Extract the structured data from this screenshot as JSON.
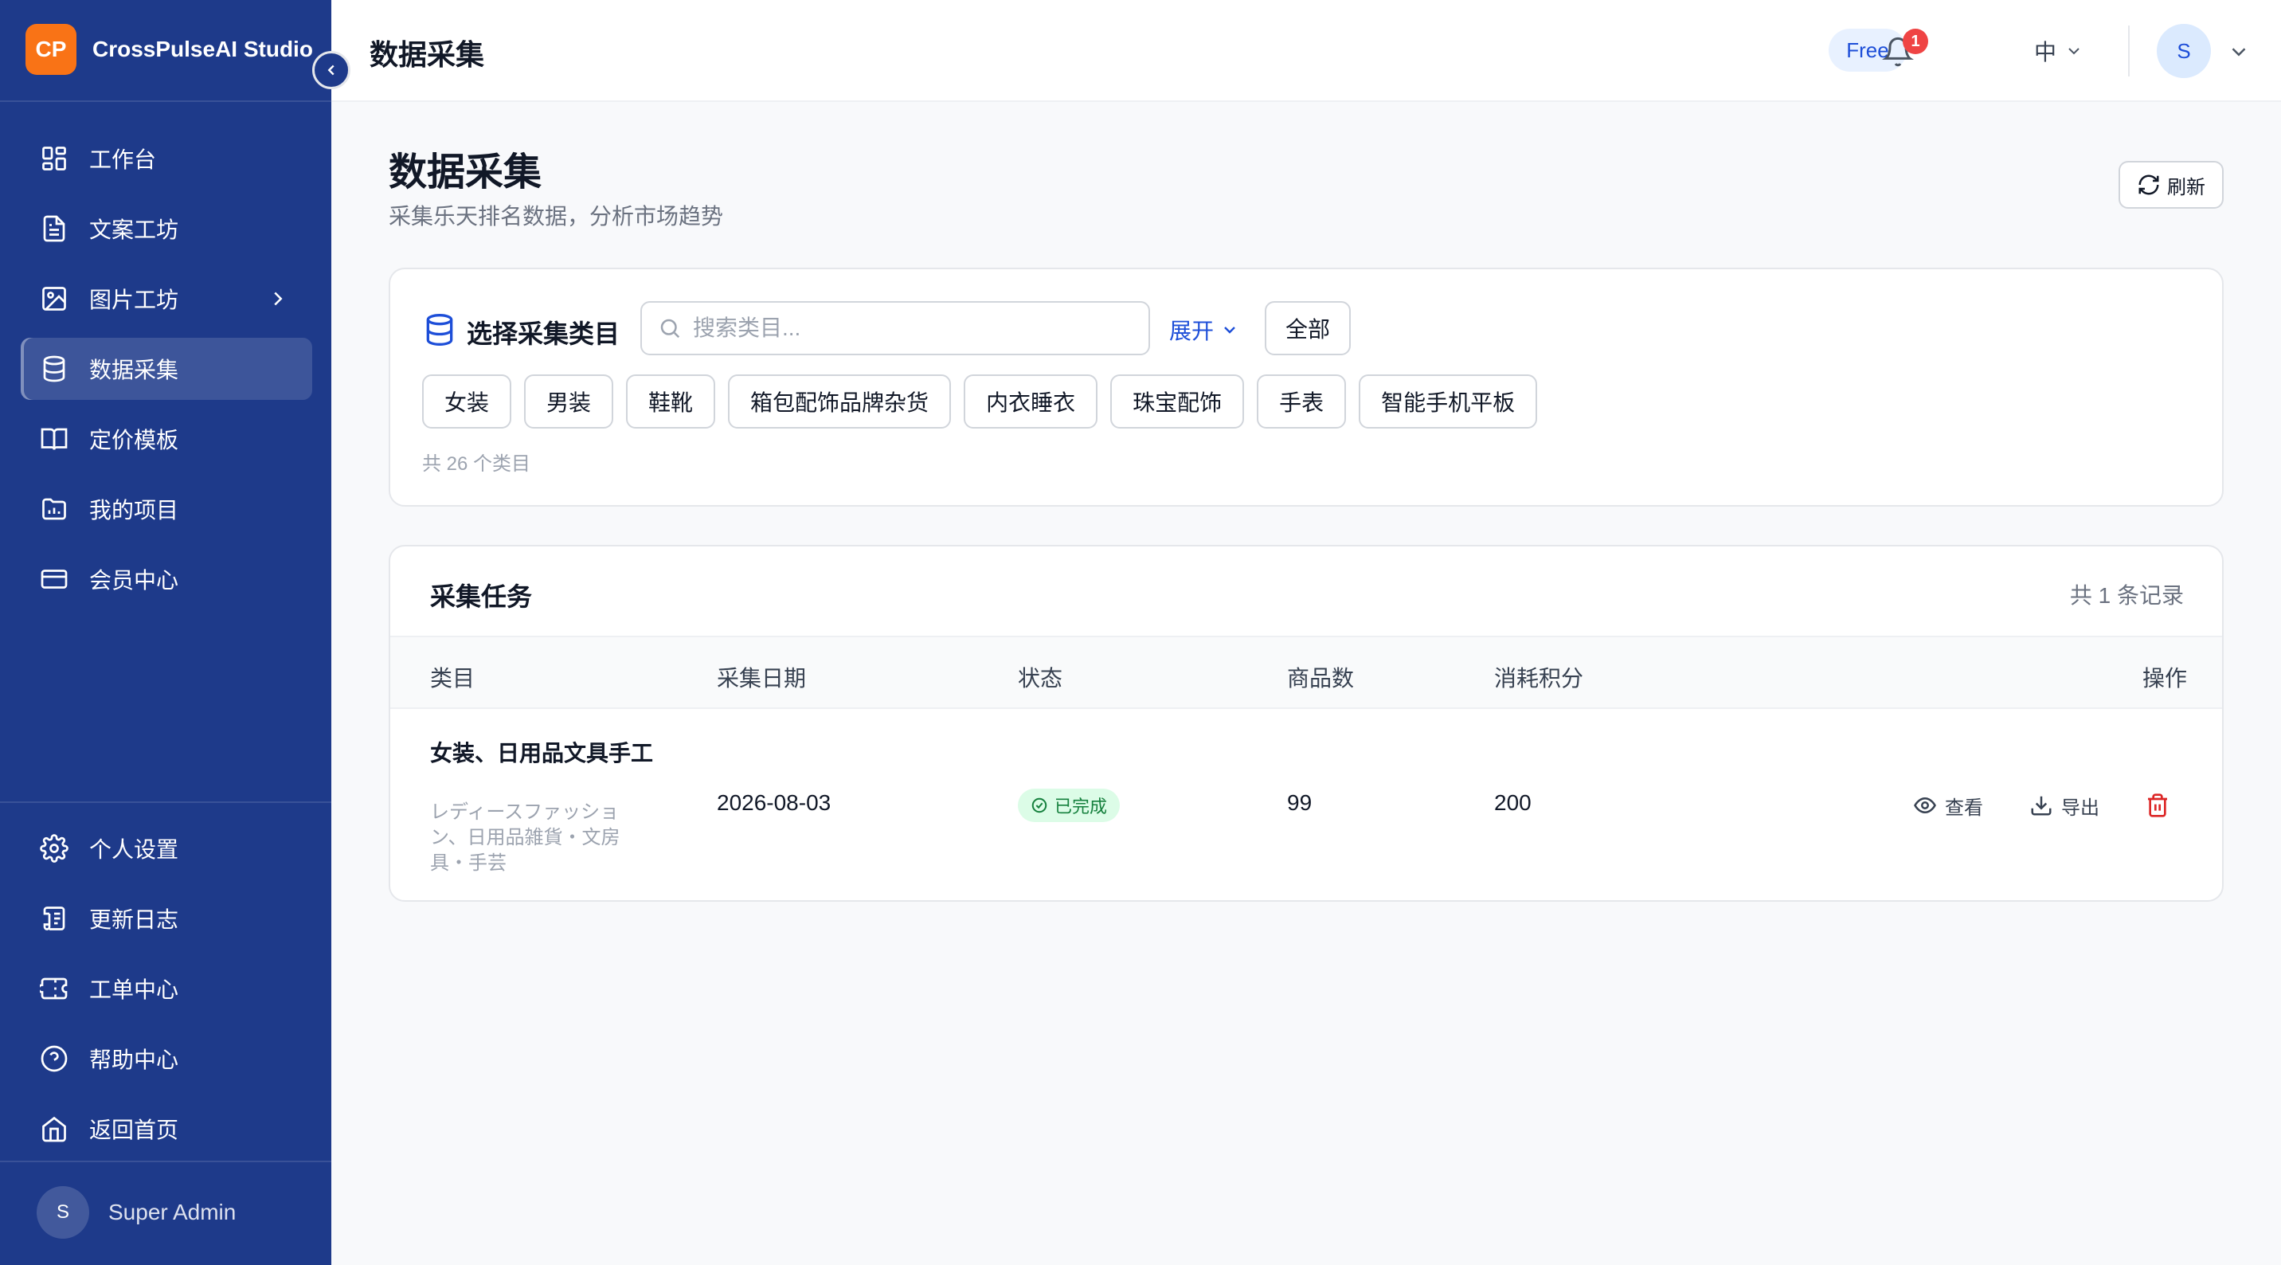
{
  "brand": {
    "logo_text": "CP",
    "name": "CrossPulseAI Studio",
    "accent": "#f97316"
  },
  "sidebar": {
    "items": [
      {
        "label": "工作台",
        "icon": "dashboard-icon"
      },
      {
        "label": "文案工坊",
        "icon": "document-icon"
      },
      {
        "label": "图片工坊",
        "icon": "image-icon"
      },
      {
        "label": "数据采集",
        "icon": "database-icon",
        "active": true
      },
      {
        "label": "定价模板",
        "icon": "book-icon"
      },
      {
        "label": "我的项目",
        "icon": "folder-chart-icon"
      },
      {
        "label": "会员中心",
        "icon": "credit-card-icon"
      }
    ],
    "bottom_items": [
      {
        "label": "个人设置",
        "icon": "gear-icon"
      },
      {
        "label": "更新日志",
        "icon": "scroll-icon"
      },
      {
        "label": "工单中心",
        "icon": "ticket-icon"
      },
      {
        "label": "帮助中心",
        "icon": "help-icon"
      },
      {
        "label": "返回首页",
        "icon": "home-icon"
      }
    ],
    "user": {
      "avatar": "S",
      "name": "Super Admin"
    },
    "bg_color": "#1e3a8a"
  },
  "topbar": {
    "title": "数据采集",
    "plan": "Free",
    "notification_count": "1",
    "language": "中",
    "avatar": "S"
  },
  "page": {
    "title": "数据采集",
    "subtitle": "采集乐天排名数据，分析市场趋势",
    "refresh_label": "刷新"
  },
  "category_panel": {
    "title": "选择采集类目",
    "search_placeholder": "搜索类目...",
    "expand_label": "展开",
    "all_label": "全部",
    "chips": [
      "女装",
      "男装",
      "鞋靴",
      "箱包配饰品牌杂货",
      "内衣睡衣",
      "珠宝配饰",
      "手表",
      "智能手机平板"
    ],
    "count_text": "共 26 个类目"
  },
  "tasks": {
    "title": "采集任务",
    "total_text": "共 1 条记录",
    "columns": [
      "类目",
      "采集日期",
      "状态",
      "商品数",
      "消耗积分",
      "操作"
    ],
    "rows": [
      {
        "category": "女装、日用品文具手工",
        "category_sub": "レディースファッション、日用品雑貨・文房具・手芸",
        "date": "2026-08-03",
        "status": "已完成",
        "items": "99",
        "points": "200",
        "view_label": "查看",
        "export_label": "导出"
      }
    ]
  }
}
